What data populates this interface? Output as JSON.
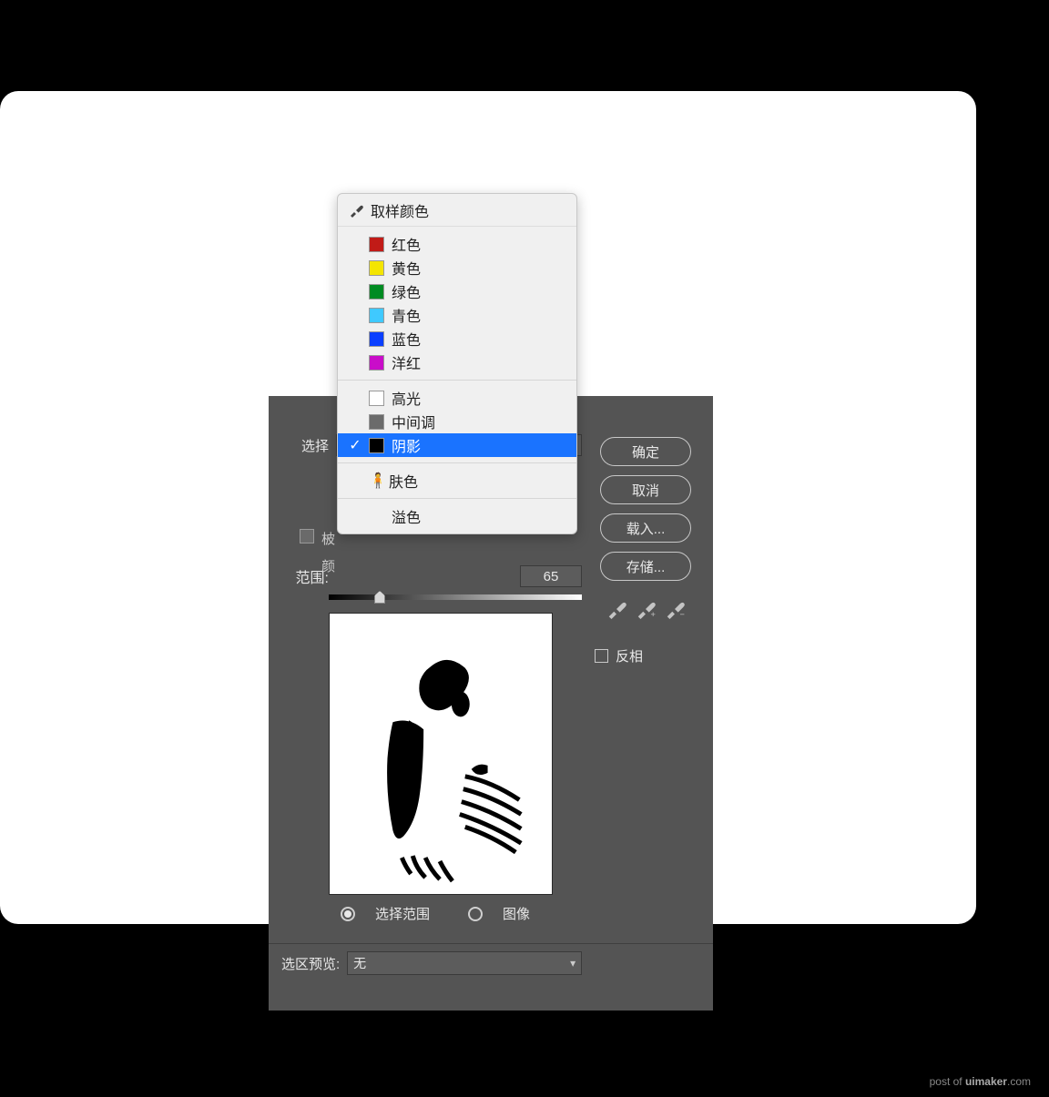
{
  "dropdown": {
    "header": "取样颜色",
    "colors": [
      {
        "label": "红色",
        "hex": "#c11b17"
      },
      {
        "label": "黄色",
        "hex": "#f4e500"
      },
      {
        "label": "绿色",
        "hex": "#008b22"
      },
      {
        "label": "青色",
        "hex": "#3fc9ff"
      },
      {
        "label": "蓝色",
        "hex": "#0b3fff"
      },
      {
        "label": "洋红",
        "hex": "#c90dc9"
      }
    ],
    "tones": [
      {
        "label": "高光",
        "hex": "#ffffff"
      },
      {
        "label": "中间调",
        "hex": "#6b6b6b"
      },
      {
        "label": "阴影",
        "hex": "#000000",
        "selected": true
      }
    ],
    "skin": "肤色",
    "spill": "溢色"
  },
  "dialog": {
    "select_label": "选择",
    "local_label": "柀",
    "color_label": "颜",
    "range_label": "范围:",
    "range_value": "65",
    "radio1": "选择范围",
    "radio2": "图像",
    "preview_label": "选区预览:",
    "preview_value": "无",
    "buttons": {
      "ok": "确定",
      "cancel": "取消",
      "load": "载入...",
      "save": "存储..."
    },
    "invert": "反相"
  },
  "watermark": {
    "prefix": "post of ",
    "brand": "uimaker",
    "suffix": ".com"
  }
}
